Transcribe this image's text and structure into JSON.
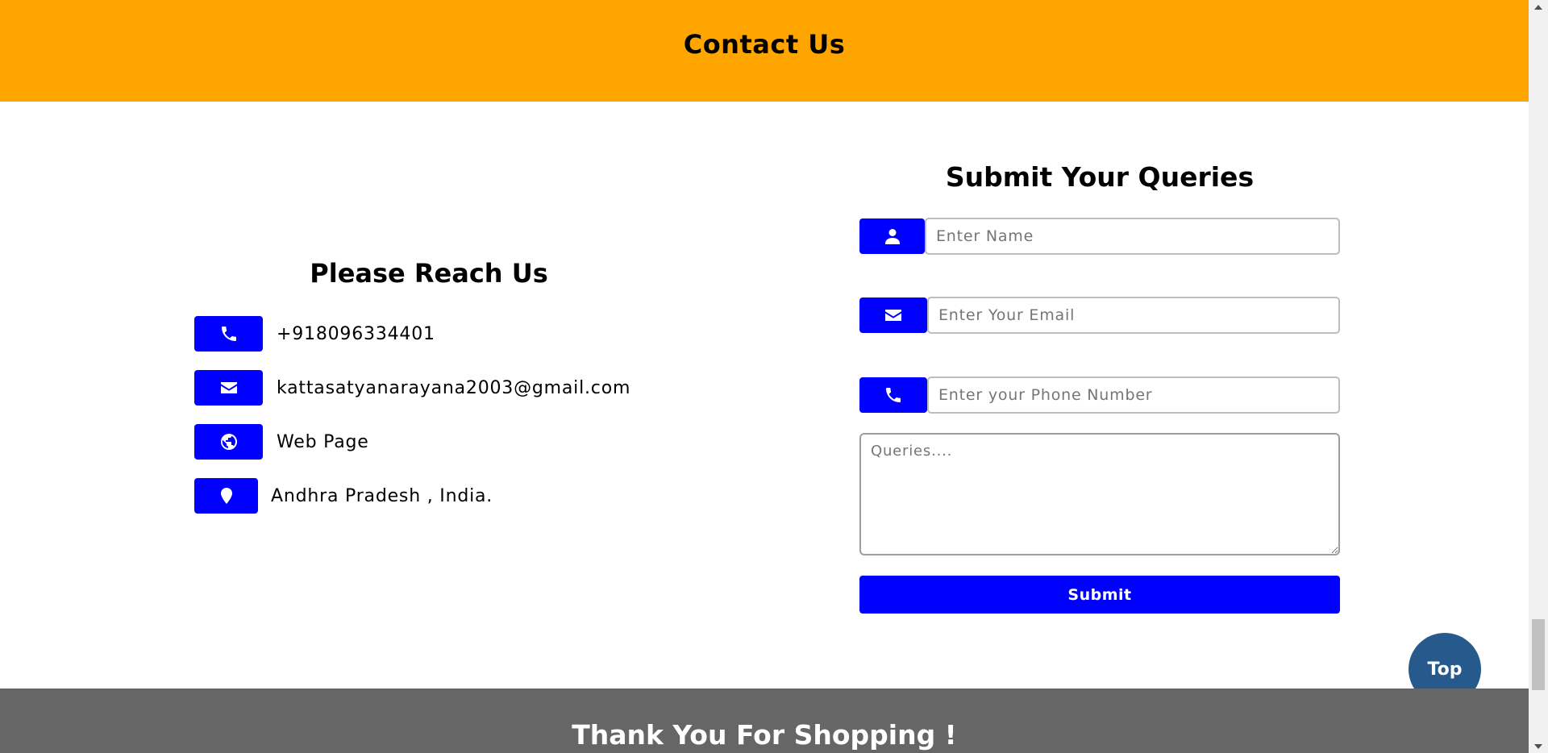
{
  "header": {
    "title": "Contact Us",
    "bg_color": "#FFA500"
  },
  "reach": {
    "title": "Please Reach Us",
    "items": [
      {
        "icon": "phone-icon",
        "text": "+918096334401"
      },
      {
        "icon": "envelope-icon",
        "text": "kattasatyanarayana2003@gmail.com"
      },
      {
        "icon": "globe-icon",
        "text": "Web Page"
      },
      {
        "icon": "map-marker-icon",
        "text": "Andhra Pradesh , India."
      }
    ]
  },
  "form": {
    "title": "Submit Your Queries",
    "name_placeholder": "Enter Name",
    "email_placeholder": "Enter Your Email",
    "phone_placeholder": "Enter your Phone Number",
    "queries_placeholder": "Queries....",
    "submit_label": "Submit",
    "accent_color": "#0000FF"
  },
  "top_button": {
    "label": "Top",
    "color": "#275A8C"
  },
  "footer": {
    "text": "Thank You For Shopping !",
    "bg_color": "#666666"
  }
}
